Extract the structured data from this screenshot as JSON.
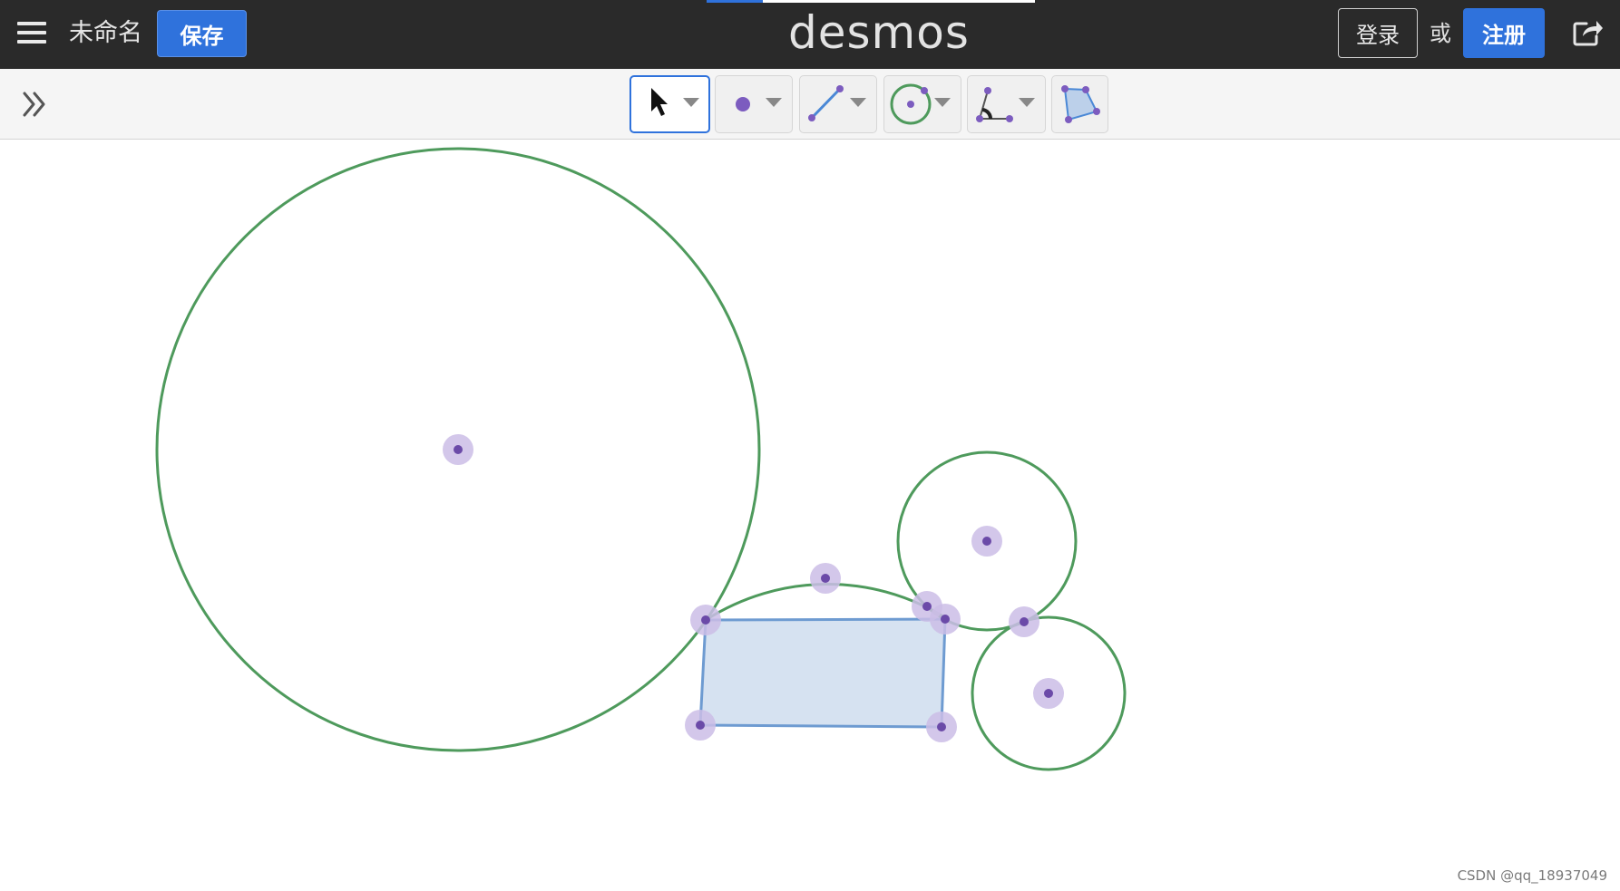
{
  "header": {
    "title": "未命名",
    "save_label": "保存",
    "logo": "desmos",
    "login_label": "登录",
    "or_text": "或",
    "signup_label": "注册",
    "load_progress": 0.17
  },
  "toolbar": {
    "tools": [
      {
        "name": "select",
        "icon": "pointer-arrow-icon",
        "selected": true
      },
      {
        "name": "point",
        "icon": "point-icon",
        "selected": false
      },
      {
        "name": "segment",
        "icon": "segment-icon",
        "selected": false
      },
      {
        "name": "circle",
        "icon": "circle-icon",
        "selected": false
      },
      {
        "name": "angle",
        "icon": "angle-icon",
        "selected": false
      },
      {
        "name": "polygon",
        "icon": "polygon-icon",
        "selected": false
      }
    ]
  },
  "colors": {
    "topbar": "#2a2a2a",
    "accent_blue": "#2f72dc",
    "circle_green": "#4e9a5c",
    "point_purple": "#6b4aa8",
    "point_halo": "#cbbde6",
    "polygon_stroke": "#6e9bd1",
    "polygon_fill": "#d6e2f1"
  },
  "watermark": "CSDN @qq_18937049"
}
